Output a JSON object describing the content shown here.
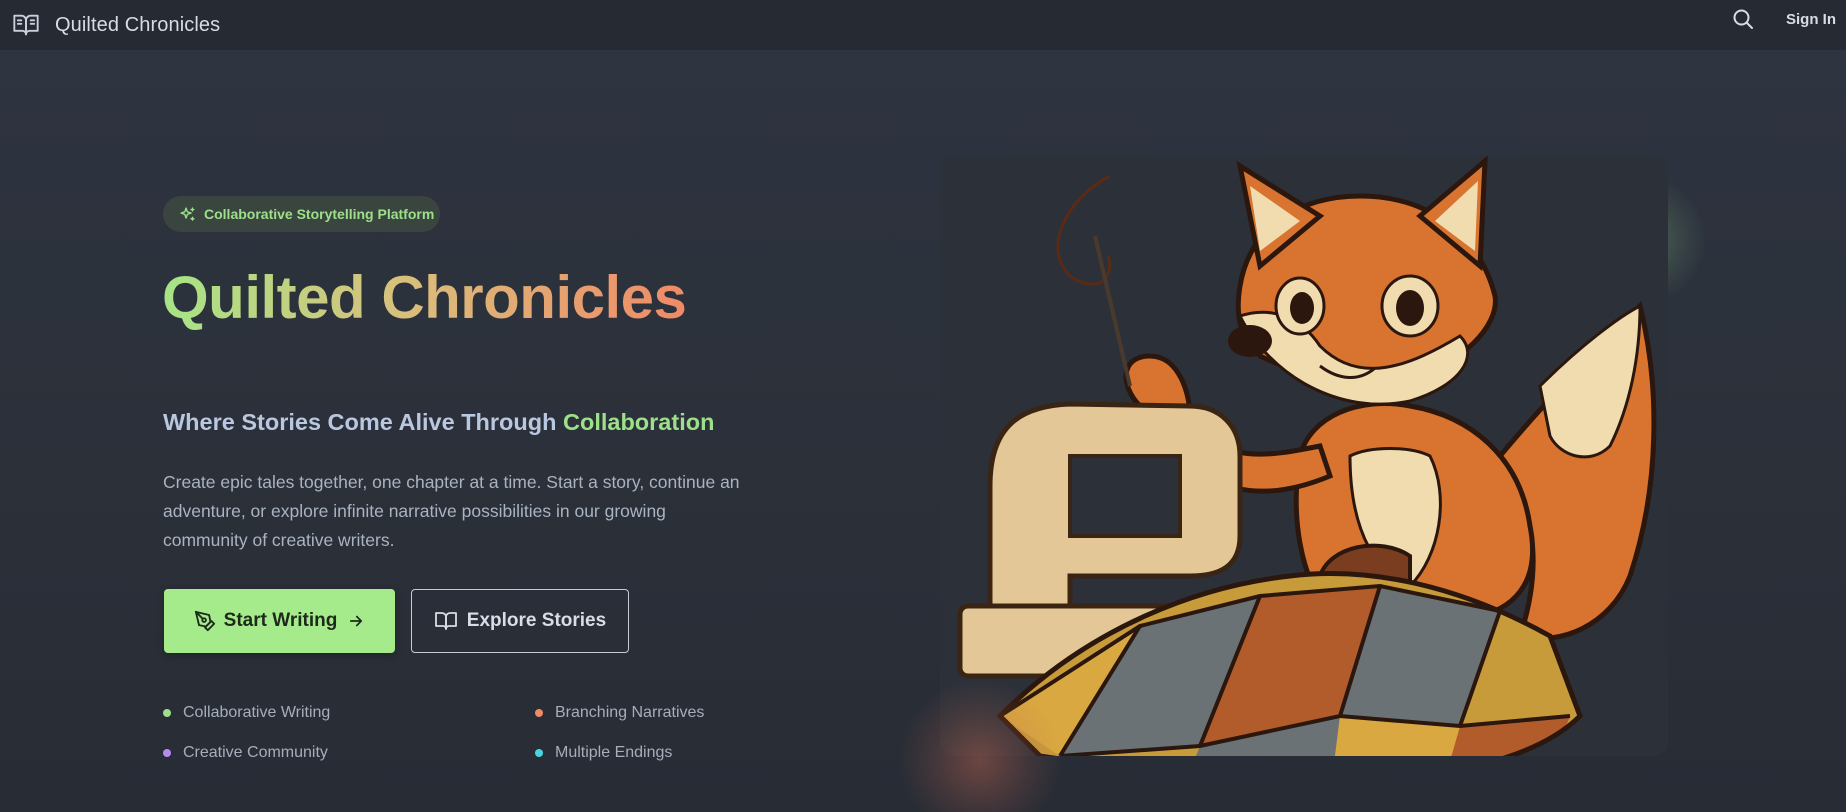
{
  "header": {
    "brand_title": "Quilted Chronicles",
    "brand_icon": "open-book-icon",
    "search_icon": "search-icon",
    "sign_in_label": "Sign In"
  },
  "hero": {
    "badge_label": "Collaborative Storytelling Platform",
    "badge_icon": "sparkles-icon",
    "title": "Quilted Chronicles",
    "subtitle_prefix": "Where Stories Come Alive Through ",
    "subtitle_accent": "Collaboration",
    "description": "Create epic tales together, one chapter at a time. Start a story, continue an adventure, or explore infinite narrative possibilities in our growing community of creative writers.",
    "primary_button": {
      "label": "Start Writing",
      "icon": "pen-tool-icon",
      "trailing_icon": "arrow-right-icon"
    },
    "secondary_button": {
      "label": "Explore Stories",
      "icon": "open-book-icon"
    },
    "features": [
      {
        "label": "Collaborative Writing",
        "color": "#9ee08a"
      },
      {
        "label": "Branching Narratives",
        "color": "#f08a67"
      },
      {
        "label": "Creative Community",
        "color": "#b48cf0"
      },
      {
        "label": "Multiple Endings",
        "color": "#46d6e6"
      }
    ],
    "illustration": "fox-sewing-quilt-illustration"
  },
  "colors": {
    "accent_green": "#a5eb8b",
    "accent_orange": "#f08a67",
    "background": "#2b303b",
    "header_bg": "#252a33"
  }
}
